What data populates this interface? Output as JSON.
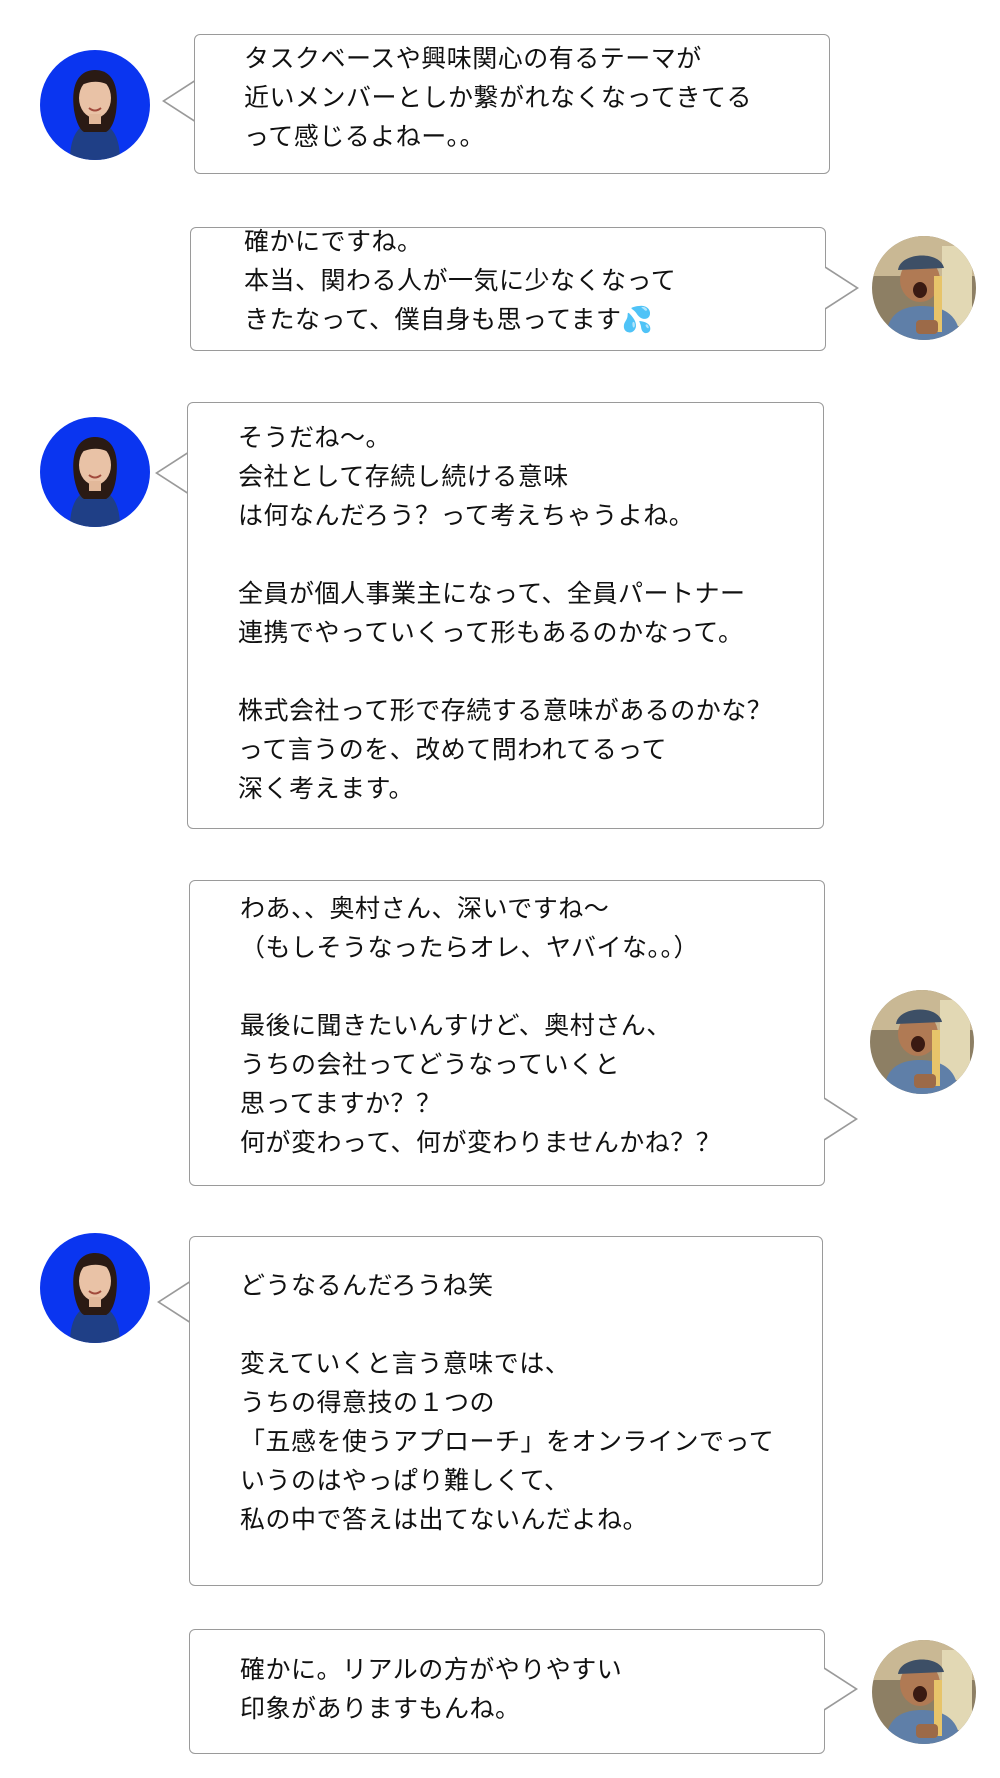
{
  "messages": [
    {
      "speaker": "woman",
      "text": "タスクベースや興味関心の有るテーマが\n近いメンバーとしか繋がれなくなってきてる\nって感じるよねー。。"
    },
    {
      "speaker": "man",
      "text": "確かにですね。\n本当、関わる人が一気に少なくなって\nきたなって、僕自身も思ってます💦"
    },
    {
      "speaker": "woman",
      "text": "そうだね〜。\n会社として存続し続ける意味\nは何なんだろう？って考えちゃうよね。\n\n全員が個人事業主になって、全員パートナー\n連携でやっていくって形もあるのかなって。\n\n株式会社って形で存続する意味があるのかな？\nって言うのを、改めて問われてるって\n深く考えます。"
    },
    {
      "speaker": "man",
      "text": "わあ、、奥村さん、深いですね〜\n（もしそうなったらオレ、ヤバイな。。）\n\n最後に聞きたいんすけど、奥村さん、\nうちの会社ってどうなっていくと\n思ってますか？？\n何が変わって、何が変わりませんかね？？"
    },
    {
      "speaker": "woman",
      "text": "どうなるんだろうね笑\n\n変えていくと言う意味では、\nうちの得意技の１つの\n「五感を使うアプローチ」をオンラインでって\nいうのはやっぱり難しくて、\n私の中で答えは出てないんだよね。"
    },
    {
      "speaker": "man",
      "text": "確かに。リアルの方がやりやすい\n印象がありますもんね。"
    }
  ],
  "colors": {
    "woman_avatar_bg": "#0a35f0",
    "bubble_border": "#9a9a9a",
    "text": "#111111"
  },
  "icons": {
    "woman_avatar": "woman-avatar-icon",
    "man_avatar": "man-avatar-icon",
    "sweat_emoji": "sweat-droplets-icon"
  }
}
